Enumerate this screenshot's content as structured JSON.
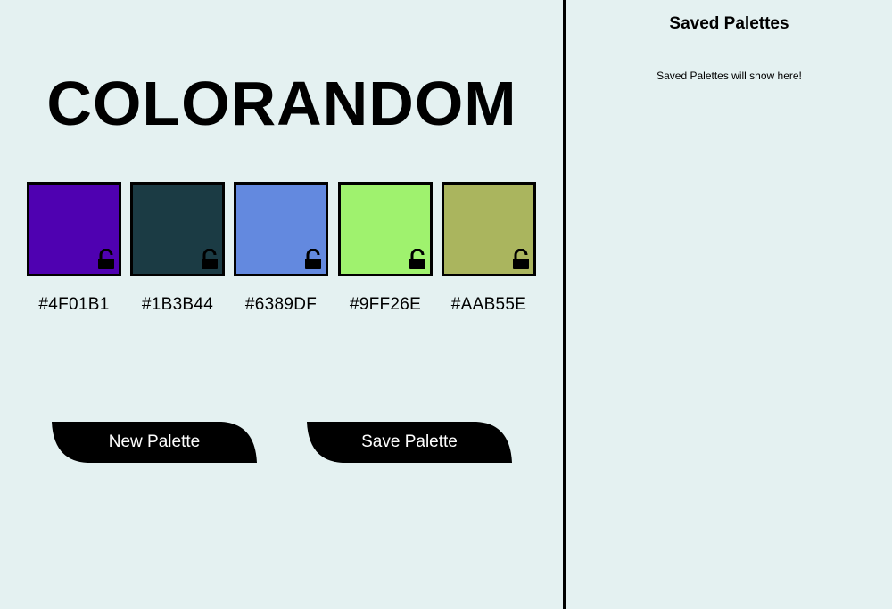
{
  "app": {
    "title": "COLORANDOM"
  },
  "palette": [
    {
      "hex": "#4F01B1",
      "color": "#4F01B1",
      "locked": false,
      "icon": "unlocked-padlock-icon"
    },
    {
      "hex": "#1B3B44",
      "color": "#1B3B44",
      "locked": false,
      "icon": "unlocked-padlock-icon"
    },
    {
      "hex": "#6389DF",
      "color": "#6389DF",
      "locked": false,
      "icon": "unlocked-padlock-icon"
    },
    {
      "hex": "#9FF26E",
      "color": "#9FF26E",
      "locked": false,
      "icon": "unlocked-padlock-icon"
    },
    {
      "hex": "#AAB55E",
      "color": "#AAB55E",
      "locked": false,
      "icon": "unlocked-padlock-icon"
    }
  ],
  "buttons": {
    "new_label": "New Palette",
    "save_label": "Save Palette"
  },
  "sidebar": {
    "title": "Saved Palettes",
    "empty_message": "Saved Palettes will show here!"
  },
  "colors": {
    "background": "#e4f1f1",
    "text": "#000000",
    "button_bg": "#000000",
    "button_text": "#ffffff",
    "divider": "#000000"
  }
}
